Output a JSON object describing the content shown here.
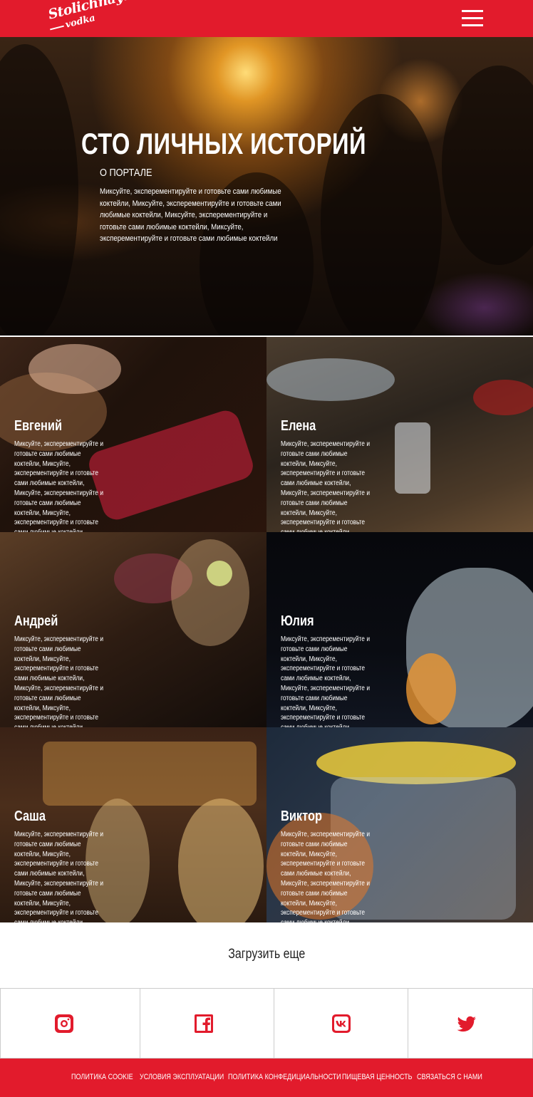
{
  "header": {
    "logo_line1": "Stolichnaya",
    "logo_line2": "vodka",
    "menu_icon": "hamburger-menu-icon"
  },
  "hero": {
    "title": "СТО ЛИЧНЫХ ИСТОРИЙ",
    "subtitle": "О ПОРТАЛЕ",
    "text": "Миксуйте, эксперементируйте и готовьте сами любимые коктейли, Миксуйте, эксперементируйте и готовьте сами любимые коктейли, Миксуйте, эксперементируйте и готовьте сами любимые коктейли, Миксуйте, эксперементируйте и готовьте сами любимые коктейли"
  },
  "stories": [
    {
      "name": "Евгений",
      "text": "Миксуйте, эксперементируйте и готовьте сами любимые коктейли, Миксуйте, эксперементируйте и готовьте сами любимые коктейли, Миксуйте, эксперементируйте и готовьте сами любимые коктейли, Миксуйте, эксперементируйте и готовьте сами любимые коктейли"
    },
    {
      "name": "Елена",
      "text": "Миксуйте, эксперементируйте и готовьте сами любимые коктейли, Миксуйте, эксперементируйте и готовьте сами любимые коктейли, Миксуйте, эксперементируйте и готовьте сами любимые коктейли, Миксуйте, эксперементируйте и готовьте сами любимые коктейли"
    },
    {
      "name": "Андрей",
      "text": "Миксуйте, эксперементируйте и готовьте сами любимые коктейли, Миксуйте, эксперементируйте и готовьте сами любимые коктейли, Миксуйте, эксперементируйте и готовьте сами любимые коктейли, Миксуйте, эксперементируйте и готовьте сами любимые коктейли"
    },
    {
      "name": "Юлия",
      "text": "Миксуйте, эксперементируйте и готовьте сами любимые коктейли, Миксуйте, эксперементируйте и готовьте сами любимые коктейли, Миксуйте, эксперементируйте и готовьте сами любимые коктейли, Миксуйте, эксперементируйте и готовьте сами любимые коктейли"
    },
    {
      "name": "Саша",
      "text": "Миксуйте, эксперементируйте и готовьте сами любимые коктейли, Миксуйте, эксперементируйте и готовьте сами любимые коктейли, Миксуйте, эксперементируйте и готовьте сами любимые коктейли, Миксуйте, эксперементируйте и готовьте сами любимые коктейли"
    },
    {
      "name": "Виктор",
      "text": "Миксуйте, эксперементируйте и готовьте сами любимые коктейли, Миксуйте, эксперементируйте и готовьте сами любимые коктейли, Миксуйте, эксперементируйте и готовьте сами любимые коктейли, Миксуйте, эксперементируйте и готовьте сами любимые коктейли"
    }
  ],
  "load_more": "Загрузить еще",
  "social": [
    {
      "icon": "instagram-icon"
    },
    {
      "icon": "facebook-icon"
    },
    {
      "icon": "vk-icon"
    },
    {
      "icon": "twitter-icon"
    }
  ],
  "footer": {
    "links": [
      "ПОЛИТИКА COOKIE",
      "УСЛОВИЯ ЭКСПЛУАТАЦИИ",
      "ПОЛИТИКА КОНФЕДИЦИАЛЬНОСТИ",
      "ПИЩЕВАЯ ЦЕННОСТЬ",
      "СВЯЗАТЬСЯ С НАМИ"
    ]
  },
  "colors": {
    "brand_red": "#e21b2c",
    "text_dark": "#222222",
    "border": "#cccccc"
  }
}
